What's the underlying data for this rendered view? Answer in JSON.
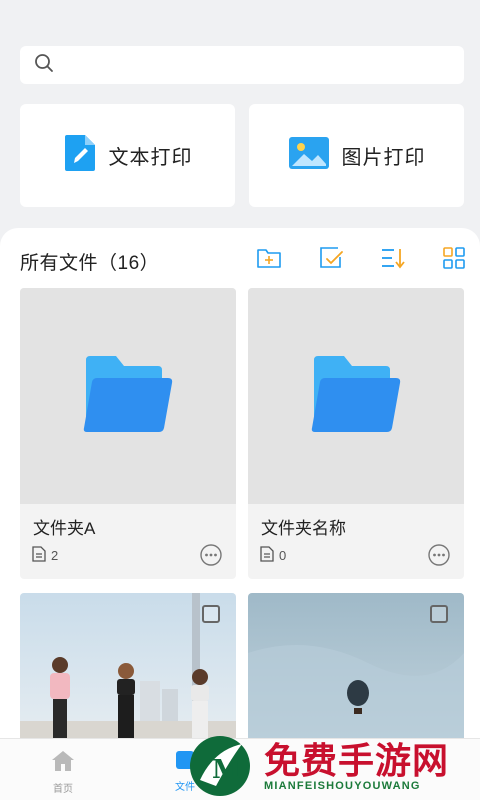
{
  "search": {
    "placeholder": ""
  },
  "quick_actions": [
    {
      "label": "文本打印",
      "icon": "document-edit-icon"
    },
    {
      "label": "图片打印",
      "icon": "image-icon"
    }
  ],
  "files_section": {
    "title": "所有文件（16）",
    "tools": [
      "new-folder-icon",
      "select-icon",
      "sort-icon",
      "grid-view-icon"
    ]
  },
  "folders": [
    {
      "name": "文件夹A",
      "count": "2"
    },
    {
      "name": "文件夹名称",
      "count": "0"
    }
  ],
  "bottom_nav": {
    "items": [
      {
        "label": "首页",
        "icon": "home-icon"
      },
      {
        "label": "文件",
        "icon": "files-icon"
      }
    ]
  },
  "watermark": {
    "title": "免费手游网",
    "subtitle": "MIANFEISHOUYOUWANG"
  },
  "colors": {
    "accent_blue": "#2196f3",
    "accent_orange": "#f5a623",
    "folder_blue": "#2f8ff0",
    "watermark_red": "#c8102e",
    "watermark_green": "#1b7a3a"
  }
}
